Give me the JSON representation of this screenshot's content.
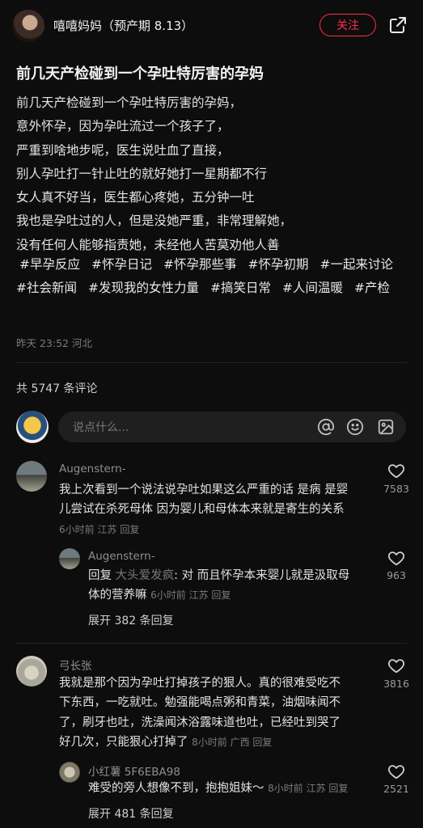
{
  "header": {
    "author_name": "嘻嘻妈妈（预产期 8.13）",
    "follow_label": "关注"
  },
  "note": {
    "title": "前几天产检碰到一个孕吐特厉害的孕妈",
    "lines": [
      "前几天产检碰到一个孕吐特厉害的孕妈，",
      "意外怀孕，因为孕吐流过一个孩子了，",
      "严重到啥地步呢，医生说吐血了直接，",
      "别人孕吐打一针止吐的就好她打一星期都不行",
      "女人真不好当，医生都心疼她，五分钟一吐",
      "我也是孕吐过的人，但是没她严重，非常理解她，",
      "没有任何人能够指责她，未经他人苦莫劝他人善"
    ],
    "tags": [
      "#早孕反应",
      "#怀孕日记",
      "#怀孕那些事",
      "#怀孕初期",
      "#一起来讨论",
      "#社会新闻",
      "#发现我的女性力量",
      "#搞笑日常",
      "#人间温暖",
      "#产检"
    ],
    "time": "昨天 23:52",
    "location": "河北"
  },
  "comments_summary": {
    "count_label": "共 5747 条评论",
    "input_placeholder": "说点什么..."
  },
  "comments": [
    {
      "user": "Augenstern-",
      "lines": [
        "我上次看到一个说法说孕吐如果这么严重的话 是病 是婴",
        "儿尝试在杀死母体 因为婴儿和母体本来就是寄生的关系"
      ],
      "time": "6小时前",
      "location": "江苏",
      "reply_label": "回复",
      "likes": "7583",
      "reply": {
        "user": "Augenstern-",
        "prefix": "回复",
        "target": "大头爱发疯",
        "line1": ": 对 而且怀孕本来婴儿就是汲取母",
        "line2": "体的营养嘛",
        "time": "6小时前",
        "location": "江苏",
        "reply_label": "回复",
        "likes": "963"
      },
      "expand": "展开 382 条回复"
    },
    {
      "user": "弓长张",
      "lines": [
        "我就是那个因为孕吐打掉孩子的狠人。真的很难受吃不",
        "下东西，一吃就吐。勉强能喝点粥和青菜，油烟味闻不",
        "了，刷牙也吐，洗澡闻沐浴露味道也吐，已经吐到哭了",
        "好几次，只能狠心打掉了"
      ],
      "time": "8小时前",
      "location": "广西",
      "reply_label": "回复",
      "likes": "3816",
      "reply": {
        "user": "小红薯 5F6EBA98",
        "text": "难受的旁人想像不到，抱抱姐妹～",
        "time": "8小时前",
        "location": "江苏",
        "reply_label": "回复",
        "likes": "2521"
      },
      "expand": "展开 481 条回复"
    }
  ],
  "icons": {
    "share": "share-icon",
    "like": "heart-outline-icon",
    "mention": "at-icon",
    "emoji": "emoji-icon",
    "image": "image-icon"
  },
  "colors": {
    "background": "#0d0d0d",
    "accent": "#ff2e4d"
  }
}
